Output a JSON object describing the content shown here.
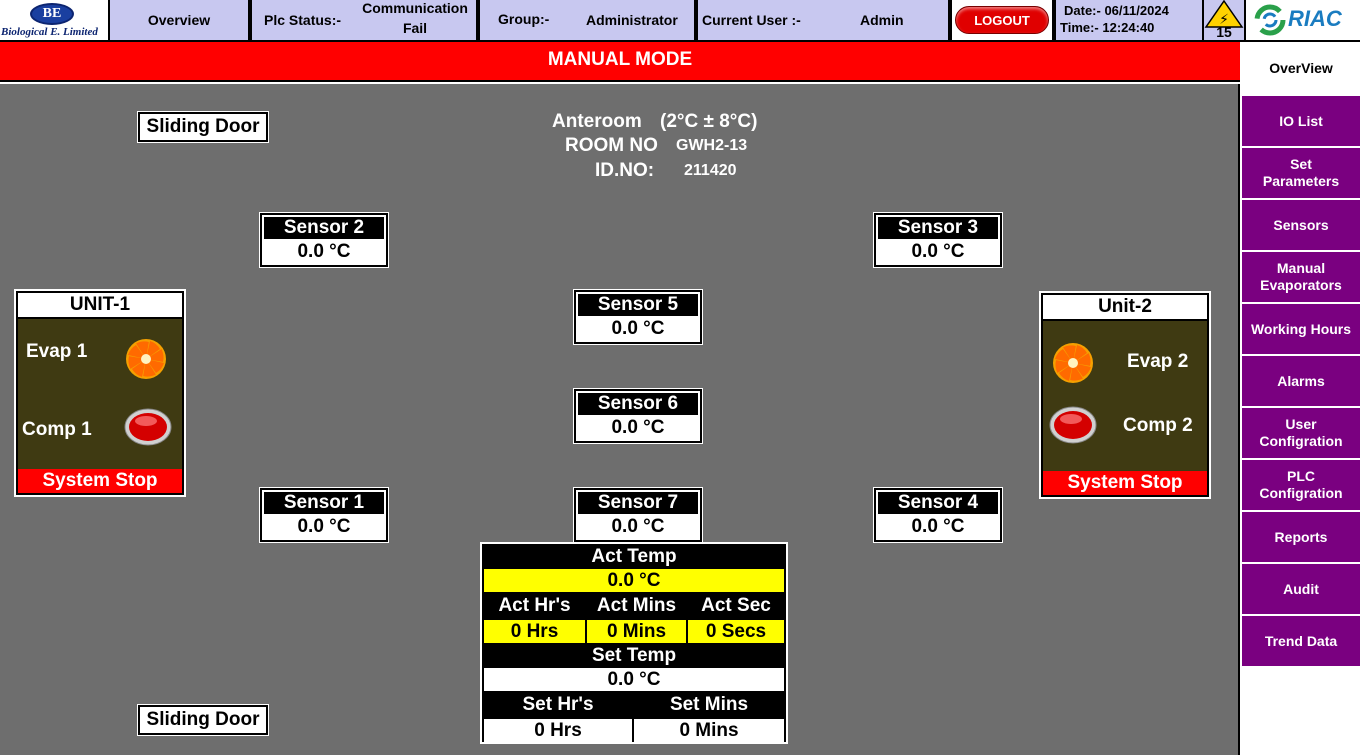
{
  "header": {
    "logo_be_mark": "BE",
    "logo_be_name": "Biological E. Limited",
    "overview_tab": "Overview",
    "plc_status_label": "Plc Status:-",
    "plc_status_value_line1": "Communication",
    "plc_status_value_line2": "Fail",
    "group_label": "Group:-",
    "group_value": "Administrator",
    "current_user_label": "Current User :-",
    "current_user_value": "Admin",
    "logout_label": "LOGOUT",
    "date_text": "Date:- 06/11/2024",
    "time_text": "Time:- 12:24:40",
    "alarm_count": "15",
    "riac_logo": "RIAC"
  },
  "banner": {
    "mode": "MANUAL MODE"
  },
  "room": {
    "name": "Anteroom",
    "range": "(2°C ± 8°C)",
    "room_no_label": "ROOM NO",
    "room_no_value": "GWH2-13",
    "id_label": "ID.NO:",
    "id_value": "211420"
  },
  "doors": {
    "top": "Sliding Door",
    "bottom": "Sliding Door"
  },
  "sensors": [
    {
      "name": "Sensor 1",
      "value": "0.0 °C"
    },
    {
      "name": "Sensor 2",
      "value": "0.0 °C"
    },
    {
      "name": "Sensor 3",
      "value": "0.0 °C"
    },
    {
      "name": "Sensor 4",
      "value": "0.0 °C"
    },
    {
      "name": "Sensor 5",
      "value": "0.0 °C"
    },
    {
      "name": "Sensor 6",
      "value": "0.0 °C"
    },
    {
      "name": "Sensor 7",
      "value": "0.0 °C"
    }
  ],
  "units": [
    {
      "title": "UNIT-1",
      "evap": "Evap 1",
      "comp": "Comp 1",
      "status": "System Stop"
    },
    {
      "title": "Unit-2",
      "evap": "Evap 2",
      "comp": "Comp 2",
      "status": "System Stop"
    }
  ],
  "timer": {
    "act_temp_label": "Act Temp",
    "act_temp_value": "0.0 °C",
    "act_hrs_label": "Act  Hr's",
    "act_mins_label": "Act Mins",
    "act_sec_label": "Act Sec",
    "act_hrs_value": "0 Hrs",
    "act_mins_value": "0 Mins",
    "act_secs_value": "0 Secs",
    "set_temp_label": "Set Temp",
    "set_temp_value": "0.0 °C",
    "set_hrs_label": "Set  Hr's",
    "set_mins_label": "Set Mins",
    "set_hrs_value": "0 Hrs",
    "set_mins_value": "0 Mins"
  },
  "sidebar": {
    "items": [
      {
        "label": "OverView",
        "active": true
      },
      {
        "label": "IO List"
      },
      {
        "label": "Set Parameters"
      },
      {
        "label": "Sensors"
      },
      {
        "label": "Manual Evaporators"
      },
      {
        "label": "Working Hours"
      },
      {
        "label": "Alarms"
      },
      {
        "label": "User Configration"
      },
      {
        "label": "PLC Configration"
      },
      {
        "label": "Reports"
      },
      {
        "label": "Audit"
      },
      {
        "label": "Trend Data"
      }
    ]
  },
  "colors": {
    "banner_red": "#ff0000",
    "sidebar_purple": "#7a0080",
    "header_lavender": "#c8c8f0",
    "highlight_yellow": "#ffff00",
    "main_gray": "#6e6e6e",
    "unit_olive": "#3f3a12"
  },
  "icons": {
    "alarm": "warning-triangle-icon",
    "evaporator": "fan-icon",
    "compressor": "red-lamp-icon"
  }
}
